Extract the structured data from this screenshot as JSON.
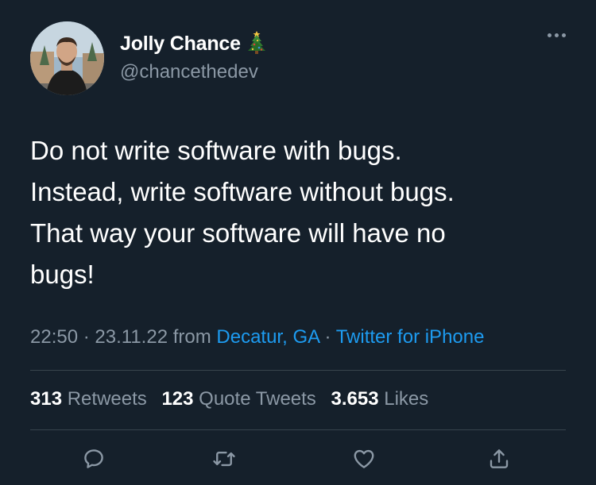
{
  "author": {
    "display_name": "Jolly Chance",
    "handle": "@chancethedev",
    "badge_icon": "christmas-tree-icon"
  },
  "tweet": {
    "text": "Do not write software with bugs.\nInstead, write software without bugs.\nThat way your software will have no\nbugs!",
    "time": "22:50",
    "date": "23.11.22",
    "from_label": "from",
    "location": "Decatur, GA",
    "client": "Twitter for iPhone",
    "separator": "·"
  },
  "stats": {
    "retweets_count": "313",
    "retweets_label": "Retweets",
    "quotes_count": "123",
    "quotes_label": "Quote Tweets",
    "likes_count": "3.653",
    "likes_label": "Likes"
  },
  "actions": [
    {
      "name": "reply",
      "icon": "reply-icon"
    },
    {
      "name": "retweet",
      "icon": "retweet-icon"
    },
    {
      "name": "like",
      "icon": "heart-icon"
    },
    {
      "name": "share",
      "icon": "share-icon"
    }
  ],
  "colors": {
    "background": "#15202b",
    "text": "#ffffff",
    "secondary_text": "#8b98a5",
    "link": "#1d9bf0",
    "divider": "#38444d"
  }
}
